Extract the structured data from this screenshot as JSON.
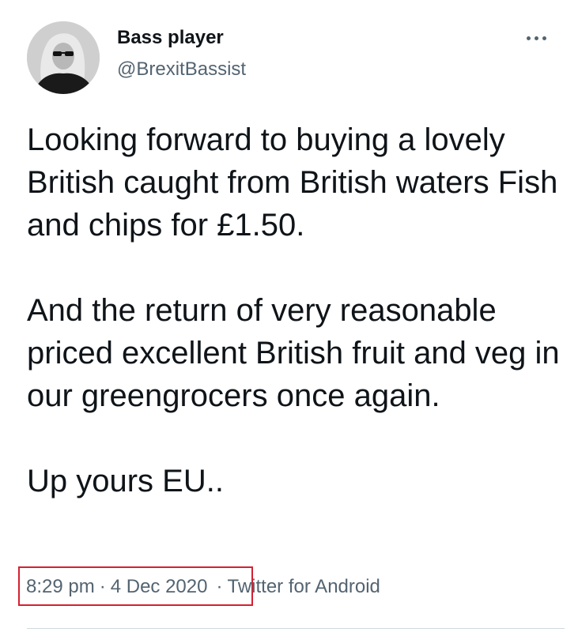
{
  "author": {
    "display_name": "Bass player",
    "handle": "@BrexitBassist"
  },
  "tweet": {
    "paragraphs": [
      "Looking forward to buying a lovely British caught from British waters Fish and chips for £1.50.",
      "And the return of very reasonable priced excellent British fruit and veg in our greengrocers once again.",
      "Up yours EU.."
    ]
  },
  "meta": {
    "time": "8:29 pm",
    "date": "4 Dec 2020",
    "source": "Twitter for Android"
  },
  "icons": {
    "more": "more-horizontal-icon"
  },
  "colors": {
    "text_primary": "#0f1419",
    "text_secondary": "#536471",
    "highlight_box": "#d62030"
  }
}
